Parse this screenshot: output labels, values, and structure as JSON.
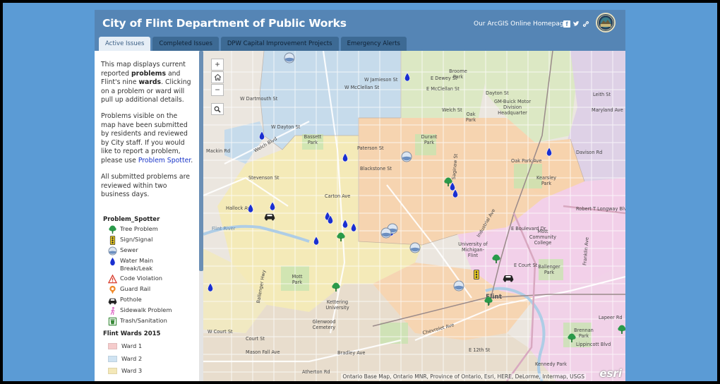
{
  "header": {
    "title": "City of Flint Department of Public Works",
    "homepage_link": "Our ArcGIS Online Homepage!",
    "share_icons": [
      "facebook-icon",
      "twitter-icon",
      "link-icon"
    ]
  },
  "tabs": [
    {
      "label": "Active Issues",
      "active": true
    },
    {
      "label": "Completed Issues",
      "active": false
    },
    {
      "label": "DPW Capital Improvement Projects",
      "active": false
    },
    {
      "label": "Emergency Alerts",
      "active": false
    }
  ],
  "sidebar": {
    "intro": {
      "part1": "This map displays current reported ",
      "bold1": "problems",
      "part2": " and Flint's nine ",
      "bold2": "wards",
      "part3": ". Clicking on a problem or ward will pull up additional details."
    },
    "spotter": {
      "text": "Problems visible on the map have been submitted by residents and reviewed by City staff. If you would like to report a problem, please use ",
      "link": "Problem Spotter",
      "end": "."
    },
    "review_note": "All submitted problems are reviewed within two business days.",
    "legend_title": "Problem_Spotter",
    "legend": [
      {
        "icon": "tree-icon",
        "label": "Tree Problem"
      },
      {
        "icon": "traffic-signal-icon",
        "label": "Sign/Signal"
      },
      {
        "icon": "sewer-icon",
        "label": "Sewer"
      },
      {
        "icon": "water-drop-icon",
        "label": "Water Main Break/Leak"
      },
      {
        "icon": "warning-triangle-icon",
        "label": "Code Violation"
      },
      {
        "icon": "guard-rail-icon",
        "label": "Guard Rail"
      },
      {
        "icon": "pothole-car-icon",
        "label": "Pothole"
      },
      {
        "icon": "sidewalk-icon",
        "label": "Sidewalk Problem"
      },
      {
        "icon": "trash-icon",
        "label": "Trash/Sanitation"
      }
    ],
    "wards_title": "Flint Wards 2015",
    "wards": [
      {
        "label": "Ward 1",
        "color": "#f5cccc"
      },
      {
        "label": "Ward 2",
        "color": "#cfe3f2"
      },
      {
        "label": "Ward 3",
        "color": "#f4e8b8"
      }
    ]
  },
  "map": {
    "zoom_in": "+",
    "zoom_out": "−",
    "attribution": "Ontario Base Map, Ontario MNR, Province of Ontario, Esri, HERE, DeLorme, Intermap, USGS",
    "esri_logo": "esri",
    "ward_colors": {
      "ward_blue": "#c2daec",
      "ward_yellow": "#f4eab5",
      "ward_orange": "#f7d3ad",
      "ward_green": "#dbe8c2",
      "ward_pink": "#f2cfe9",
      "ward_purple": "#ddd0e6",
      "ward_tan": "#e8dccb"
    },
    "labels": [
      "W Jamieson St",
      "W McClellan St",
      "W Dartmouth St",
      "W Dayton St",
      "Bassett Park",
      "Paterson St",
      "Blackstone St",
      "Mackin Rd",
      "Stevenson St",
      "Welch Blvd",
      "Flint River",
      "Hallock Ave",
      "Carton Ave",
      "Mott Park",
      "Kettering University",
      "Glenwood Cemetery",
      "Bradley Ave",
      "Court St",
      "Ballenger Hwy",
      "W Court St",
      "Mason Fall Ave",
      "Durant Park",
      "E Dewey St",
      "E McClellan St",
      "Broome Park",
      "Oak Park",
      "GM-Buick Motor Division Headquarter",
      "Dayton St",
      "Welch St",
      "Leith St",
      "Maryland Ave",
      "Davison Rd",
      "Oak Park Ave",
      "Kearsley Park",
      "Robert T Longway Blvd",
      "E Boulevard Dr",
      "Mott Community College",
      "University of Michigan-Flint",
      "Flint",
      "E Court St",
      "Ballenger Park",
      "Brennan Park",
      "Lippincott Blvd",
      "E 12th St",
      "Atherton Rd",
      "Chevrolet Ave",
      "Kennedy Park",
      "Lapeer Rd",
      "Franklin Ave",
      "Saginaw St",
      "Industrial Ave"
    ]
  }
}
